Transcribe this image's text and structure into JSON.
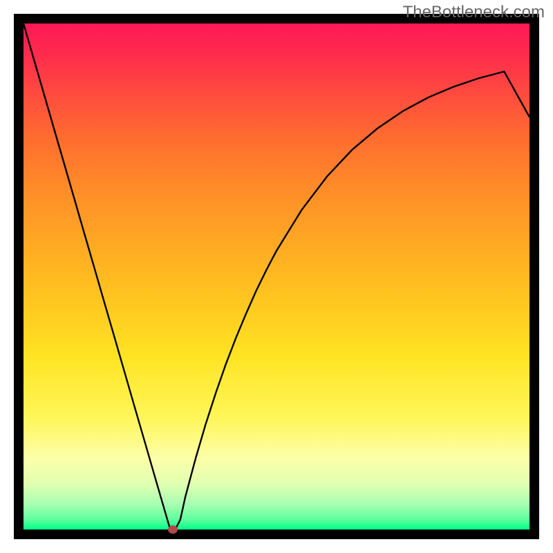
{
  "watermark": "TheBottleneck.com",
  "colors": {
    "frame": "#000000",
    "curve": "#000000",
    "marker": "#b04a4a",
    "gradient_top": "#ff1957",
    "gradient_bottom": "#00ff88"
  },
  "chart_data": {
    "type": "line",
    "title": "",
    "xlabel": "",
    "ylabel": "",
    "xlim": [
      0,
      100
    ],
    "ylim": [
      0,
      100
    ],
    "x": [
      0,
      2,
      4,
      6,
      8,
      10,
      12,
      14,
      16,
      18,
      20,
      22,
      24,
      26,
      28,
      29,
      30,
      31,
      32,
      34,
      36,
      38,
      40,
      42,
      44,
      46,
      48,
      50,
      55,
      60,
      65,
      70,
      75,
      80,
      85,
      90,
      95,
      100
    ],
    "values": [
      100,
      93.1,
      86.2,
      79.3,
      72.4,
      65.5,
      58.6,
      51.7,
      44.8,
      37.9,
      31.0,
      24.1,
      17.2,
      10.3,
      3.4,
      0,
      0,
      2,
      6.5,
      14.0,
      20.8,
      27.0,
      32.7,
      37.9,
      42.7,
      47.2,
      51.3,
      55.1,
      63.2,
      69.8,
      75.1,
      79.3,
      82.7,
      85.4,
      87.5,
      89.2,
      90.5,
      81.5
    ],
    "series": [
      {
        "name": "bottleneck-curve",
        "x": [
          0,
          2,
          4,
          6,
          8,
          10,
          12,
          14,
          16,
          18,
          20,
          22,
          24,
          26,
          28,
          29,
          30,
          31,
          32,
          34,
          36,
          38,
          40,
          42,
          44,
          46,
          48,
          50,
          55,
          60,
          65,
          70,
          75,
          80,
          85,
          90,
          95,
          100
        ],
        "y": [
          100,
          93.1,
          86.2,
          79.3,
          72.4,
          65.5,
          58.6,
          51.7,
          44.8,
          37.9,
          31.0,
          24.1,
          17.2,
          10.3,
          3.4,
          0,
          0,
          2,
          6.5,
          14.0,
          20.8,
          27.0,
          32.7,
          37.9,
          42.7,
          47.2,
          51.3,
          55.1,
          63.2,
          69.8,
          75.1,
          79.3,
          82.7,
          85.4,
          87.5,
          89.2,
          90.5,
          81.5
        ]
      }
    ],
    "marker": {
      "x": 29.5,
      "y": 0
    },
    "grid": false,
    "legend": false
  }
}
